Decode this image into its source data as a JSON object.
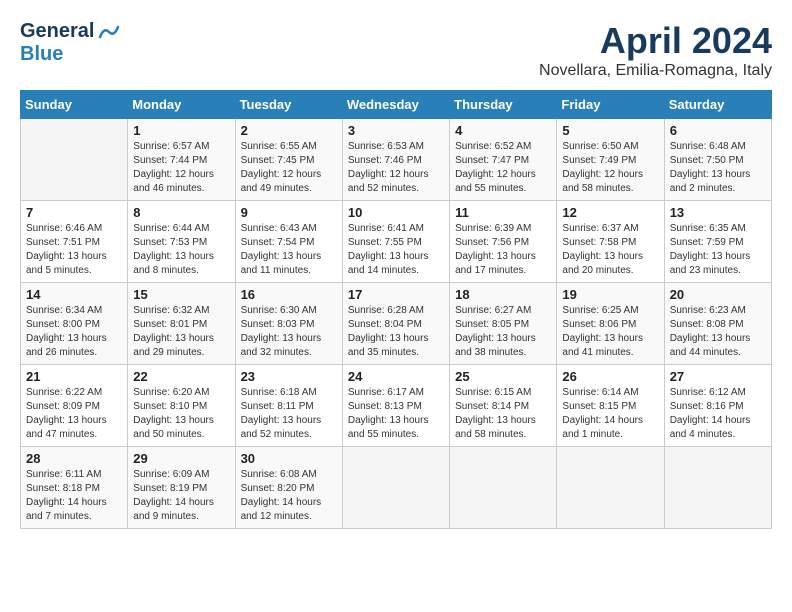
{
  "header": {
    "logo_general": "General",
    "logo_blue": "Blue",
    "month_title": "April 2024",
    "subtitle": "Novellara, Emilia-Romagna, Italy"
  },
  "days_of_week": [
    "Sunday",
    "Monday",
    "Tuesday",
    "Wednesday",
    "Thursday",
    "Friday",
    "Saturday"
  ],
  "weeks": [
    [
      {
        "day": "",
        "info": ""
      },
      {
        "day": "1",
        "info": "Sunrise: 6:57 AM\nSunset: 7:44 PM\nDaylight: 12 hours\nand 46 minutes."
      },
      {
        "day": "2",
        "info": "Sunrise: 6:55 AM\nSunset: 7:45 PM\nDaylight: 12 hours\nand 49 minutes."
      },
      {
        "day": "3",
        "info": "Sunrise: 6:53 AM\nSunset: 7:46 PM\nDaylight: 12 hours\nand 52 minutes."
      },
      {
        "day": "4",
        "info": "Sunrise: 6:52 AM\nSunset: 7:47 PM\nDaylight: 12 hours\nand 55 minutes."
      },
      {
        "day": "5",
        "info": "Sunrise: 6:50 AM\nSunset: 7:49 PM\nDaylight: 12 hours\nand 58 minutes."
      },
      {
        "day": "6",
        "info": "Sunrise: 6:48 AM\nSunset: 7:50 PM\nDaylight: 13 hours\nand 2 minutes."
      }
    ],
    [
      {
        "day": "7",
        "info": "Sunrise: 6:46 AM\nSunset: 7:51 PM\nDaylight: 13 hours\nand 5 minutes."
      },
      {
        "day": "8",
        "info": "Sunrise: 6:44 AM\nSunset: 7:53 PM\nDaylight: 13 hours\nand 8 minutes."
      },
      {
        "day": "9",
        "info": "Sunrise: 6:43 AM\nSunset: 7:54 PM\nDaylight: 13 hours\nand 11 minutes."
      },
      {
        "day": "10",
        "info": "Sunrise: 6:41 AM\nSunset: 7:55 PM\nDaylight: 13 hours\nand 14 minutes."
      },
      {
        "day": "11",
        "info": "Sunrise: 6:39 AM\nSunset: 7:56 PM\nDaylight: 13 hours\nand 17 minutes."
      },
      {
        "day": "12",
        "info": "Sunrise: 6:37 AM\nSunset: 7:58 PM\nDaylight: 13 hours\nand 20 minutes."
      },
      {
        "day": "13",
        "info": "Sunrise: 6:35 AM\nSunset: 7:59 PM\nDaylight: 13 hours\nand 23 minutes."
      }
    ],
    [
      {
        "day": "14",
        "info": "Sunrise: 6:34 AM\nSunset: 8:00 PM\nDaylight: 13 hours\nand 26 minutes."
      },
      {
        "day": "15",
        "info": "Sunrise: 6:32 AM\nSunset: 8:01 PM\nDaylight: 13 hours\nand 29 minutes."
      },
      {
        "day": "16",
        "info": "Sunrise: 6:30 AM\nSunset: 8:03 PM\nDaylight: 13 hours\nand 32 minutes."
      },
      {
        "day": "17",
        "info": "Sunrise: 6:28 AM\nSunset: 8:04 PM\nDaylight: 13 hours\nand 35 minutes."
      },
      {
        "day": "18",
        "info": "Sunrise: 6:27 AM\nSunset: 8:05 PM\nDaylight: 13 hours\nand 38 minutes."
      },
      {
        "day": "19",
        "info": "Sunrise: 6:25 AM\nSunset: 8:06 PM\nDaylight: 13 hours\nand 41 minutes."
      },
      {
        "day": "20",
        "info": "Sunrise: 6:23 AM\nSunset: 8:08 PM\nDaylight: 13 hours\nand 44 minutes."
      }
    ],
    [
      {
        "day": "21",
        "info": "Sunrise: 6:22 AM\nSunset: 8:09 PM\nDaylight: 13 hours\nand 47 minutes."
      },
      {
        "day": "22",
        "info": "Sunrise: 6:20 AM\nSunset: 8:10 PM\nDaylight: 13 hours\nand 50 minutes."
      },
      {
        "day": "23",
        "info": "Sunrise: 6:18 AM\nSunset: 8:11 PM\nDaylight: 13 hours\nand 52 minutes."
      },
      {
        "day": "24",
        "info": "Sunrise: 6:17 AM\nSunset: 8:13 PM\nDaylight: 13 hours\nand 55 minutes."
      },
      {
        "day": "25",
        "info": "Sunrise: 6:15 AM\nSunset: 8:14 PM\nDaylight: 13 hours\nand 58 minutes."
      },
      {
        "day": "26",
        "info": "Sunrise: 6:14 AM\nSunset: 8:15 PM\nDaylight: 14 hours\nand 1 minute."
      },
      {
        "day": "27",
        "info": "Sunrise: 6:12 AM\nSunset: 8:16 PM\nDaylight: 14 hours\nand 4 minutes."
      }
    ],
    [
      {
        "day": "28",
        "info": "Sunrise: 6:11 AM\nSunset: 8:18 PM\nDaylight: 14 hours\nand 7 minutes."
      },
      {
        "day": "29",
        "info": "Sunrise: 6:09 AM\nSunset: 8:19 PM\nDaylight: 14 hours\nand 9 minutes."
      },
      {
        "day": "30",
        "info": "Sunrise: 6:08 AM\nSunset: 8:20 PM\nDaylight: 14 hours\nand 12 minutes."
      },
      {
        "day": "",
        "info": ""
      },
      {
        "day": "",
        "info": ""
      },
      {
        "day": "",
        "info": ""
      },
      {
        "day": "",
        "info": ""
      }
    ]
  ]
}
